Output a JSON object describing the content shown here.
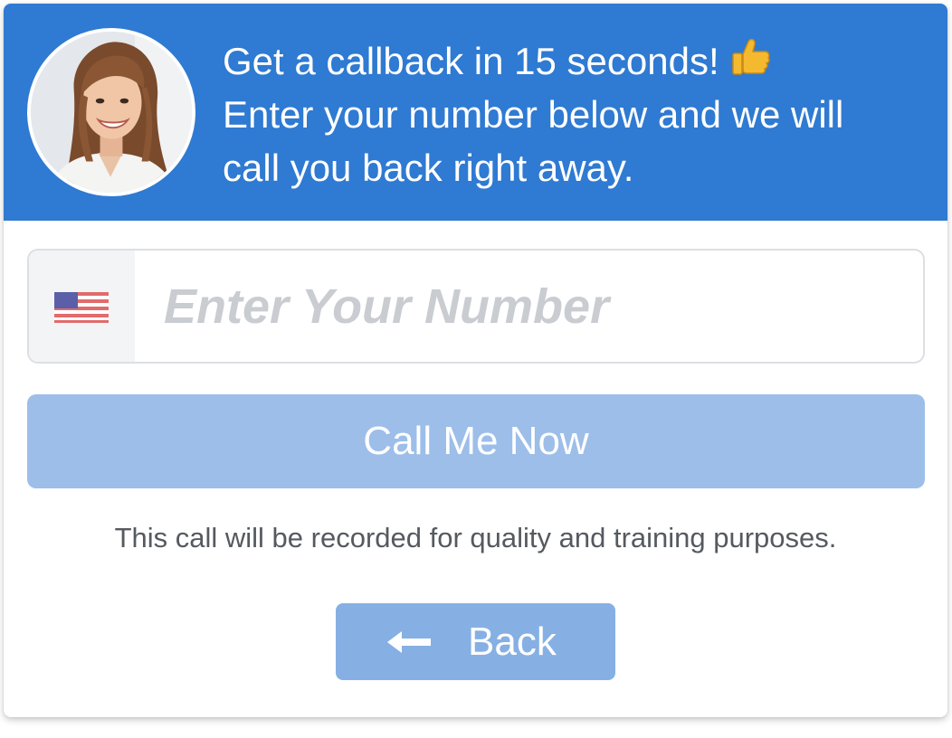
{
  "header": {
    "headline_line1": "Get a callback in 15 seconds!",
    "headline_line2": "Enter your number below and we will",
    "headline_line3": "call you back right away.",
    "background_color": "#2f7ad2",
    "thumbs_icon": "thumbs-up-icon",
    "avatar_icon": "agent-avatar"
  },
  "phone": {
    "country_flag_icon": "us-flag-icon",
    "placeholder": "Enter Your Number",
    "value": ""
  },
  "actions": {
    "call_label": "Call Me Now",
    "call_color": "#9dbee8",
    "back_label": "Back",
    "back_icon": "arrow-left-icon",
    "back_color": "#86b0e4"
  },
  "notice": "This call will be recorded for quality and training purposes."
}
